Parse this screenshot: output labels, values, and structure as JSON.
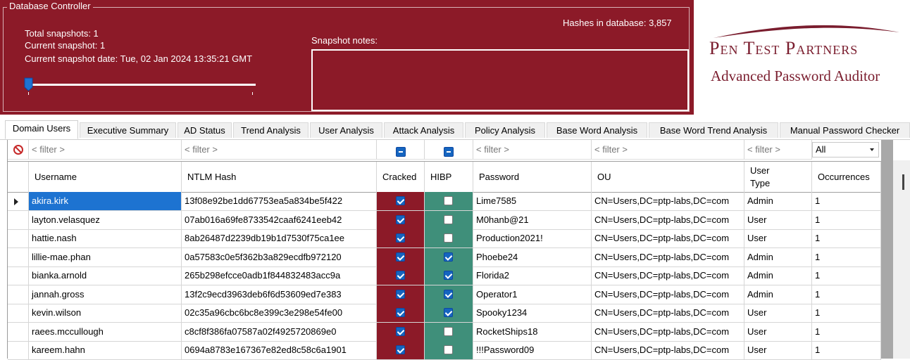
{
  "controller": {
    "title": "Database Controller",
    "total_snapshots": "Total snapshots: 1",
    "current_snapshot": "Current snapshot: 1",
    "snapshot_date": "Current snapshot date: Tue, 02 Jan 2024 13:35:21 GMT",
    "hashes": "Hashes in database: 3,857",
    "notes_label": "Snapshot notes:",
    "notes_value": "",
    "slider_position": 0
  },
  "logo": {
    "name": "Pen Test Partners",
    "subtitle": "Advanced Password Auditor"
  },
  "tabs": [
    {
      "label": "Domain Users",
      "active": true
    },
    {
      "label": "Executive Summary"
    },
    {
      "label": "AD Status"
    },
    {
      "label": "Trend Analysis"
    },
    {
      "label": "User Analysis"
    },
    {
      "label": "Attack Analysis"
    },
    {
      "label": "Policy Analysis"
    },
    {
      "label": "Base Word Analysis"
    },
    {
      "label": "Base Word Trend Analysis"
    },
    {
      "label": "Manual Password Checker"
    }
  ],
  "filters": {
    "placeholder": "< filter >",
    "user_type_select": "All"
  },
  "columns": [
    "Username",
    "NTLM Hash",
    "Cracked",
    "HIBP",
    "Password",
    "OU",
    "User\nType",
    "Occurrences"
  ],
  "rows": [
    {
      "username": "akira.kirk",
      "hash": "13f08e92be1dd67753ea5a834be5f422",
      "cracked": true,
      "hibp": false,
      "password": "Lime7585",
      "ou": "CN=Users,DC=ptp-labs,DC=com",
      "type": "Admin",
      "occ": "1"
    },
    {
      "username": "layton.velasquez",
      "hash": "07ab016a69fe8733542caaf6241eeb42",
      "cracked": true,
      "hibp": false,
      "password": "M0hanb@21",
      "ou": "CN=Users,DC=ptp-labs,DC=com",
      "type": "User",
      "occ": "1"
    },
    {
      "username": "hattie.nash",
      "hash": "8ab26487d2239db19b1d7530f75ca1ee",
      "cracked": true,
      "hibp": false,
      "password": "Production2021!",
      "ou": "CN=Users,DC=ptp-labs,DC=com",
      "type": "User",
      "occ": "1"
    },
    {
      "username": "lillie-mae.phan",
      "hash": "0a57583c0e5f362b3a829ecdfb972120",
      "cracked": true,
      "hibp": true,
      "password": "Phoebe24",
      "ou": "CN=Users,DC=ptp-labs,DC=com",
      "type": "Admin",
      "occ": "1"
    },
    {
      "username": "bianka.arnold",
      "hash": "265b298efcce0adb1f844832483acc9a",
      "cracked": true,
      "hibp": true,
      "password": "Florida2",
      "ou": "CN=Users,DC=ptp-labs,DC=com",
      "type": "Admin",
      "occ": "1"
    },
    {
      "username": "jannah.gross",
      "hash": "13f2c9ecd3963deb6f6d53609ed7e383",
      "cracked": true,
      "hibp": true,
      "password": "Operator1",
      "ou": "CN=Users,DC=ptp-labs,DC=com",
      "type": "Admin",
      "occ": "1"
    },
    {
      "username": "kevin.wilson",
      "hash": "02c35a96cbc6bc8e399c3e298e54fe00",
      "cracked": true,
      "hibp": true,
      "password": "Spooky1234",
      "ou": "CN=Users,DC=ptp-labs,DC=com",
      "type": "User",
      "occ": "1"
    },
    {
      "username": "raees.mccullough",
      "hash": "c8cf8f386fa07587a02f4925720869e0",
      "cracked": true,
      "hibp": false,
      "password": "RocketShips18",
      "ou": "CN=Users,DC=ptp-labs,DC=com",
      "type": "User",
      "occ": "1"
    },
    {
      "username": "kareem.hahn",
      "hash": "0694a8783e167367e82ed8c58c6a1901",
      "cracked": true,
      "hibp": false,
      "password": "!!!Password09",
      "ou": "CN=Users,DC=ptp-labs,DC=com",
      "type": "User",
      "occ": "1"
    }
  ],
  "colors": {
    "brand_red": "#8c1a28",
    "hibp_green": "#3f8f7a",
    "selection_blue": "#1d73d1"
  }
}
